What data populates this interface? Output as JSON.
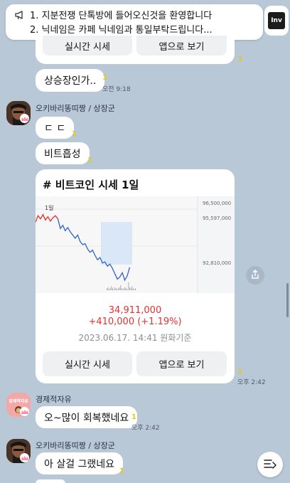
{
  "notice": {
    "line1": "1. 지분전쟁 단톡방에 들어오신것을 환영합니다",
    "line2": "2. 닉네임은 카페 닉네임과 통일부탁드립니다...",
    "inv_label": "Inv"
  },
  "top_card": {
    "btn_realtime": "실시간 시세",
    "btn_app": "앱으로 보기",
    "unread": "1"
  },
  "messages": {
    "m1": {
      "text": "상승장인가..",
      "unread": "1",
      "time": "오전 9:18"
    },
    "sender1": "오키바리똥띠짱 / 상장군",
    "m2": {
      "text": "ㄷ ㄷ",
      "unread": "1"
    },
    "m3": {
      "text": "비트흡성",
      "unread": "1"
    },
    "sender2": "경제적자유",
    "avatar2_label": "경제적자유",
    "m4": {
      "text": "오~많이 회복했네요",
      "unread": "1",
      "time": "오후 2:42"
    },
    "sender3": "오키바리똥띠짱 / 상장군",
    "m5": {
      "text": "아 살걸 그랬네요",
      "unread": "1"
    }
  },
  "btc_card": {
    "title": "# 비트코인 시세 1일",
    "price": "34,911,000",
    "change": "+410,000 (+1.19%)",
    "date": "2023.06.17. 14:41 원화기준",
    "btn_realtime": "실시간 시세",
    "btn_app": "앱으로 보기",
    "unread": "1",
    "time": "오후 2:42",
    "colors": {
      "up": "#e0322f",
      "down": "#2f63c9"
    }
  },
  "chart_data": {
    "type": "line",
    "period_label": "1일",
    "y_ticks": [
      "96,500,000",
      "95,597,000",
      "92,810,000"
    ],
    "series": [
      {
        "values": [
          95.6,
          95.9,
          95.75,
          95.95,
          95.7,
          95.85,
          95.65,
          95.8,
          95.9,
          95.75
        ]
      },
      {
        "values": [
          95.75,
          95.3,
          95.45,
          95.2,
          95.35,
          95.15,
          95.0,
          94.85,
          95.0,
          94.7,
          94.55,
          94.6,
          94.35,
          94.2,
          94.3,
          94.05,
          93.85,
          93.95,
          93.7,
          93.75,
          93.55,
          93.65,
          93.45,
          93.2,
          92.95,
          93.05,
          93.25,
          92.9,
          93.1,
          93.5
        ]
      }
    ],
    "ylim": [
      92.3,
      96.8
    ]
  },
  "icons": {
    "megaphone": "megaphone-icon",
    "share": "share-icon",
    "menu": "menu-lines-icon",
    "crown": "crown-icon"
  }
}
